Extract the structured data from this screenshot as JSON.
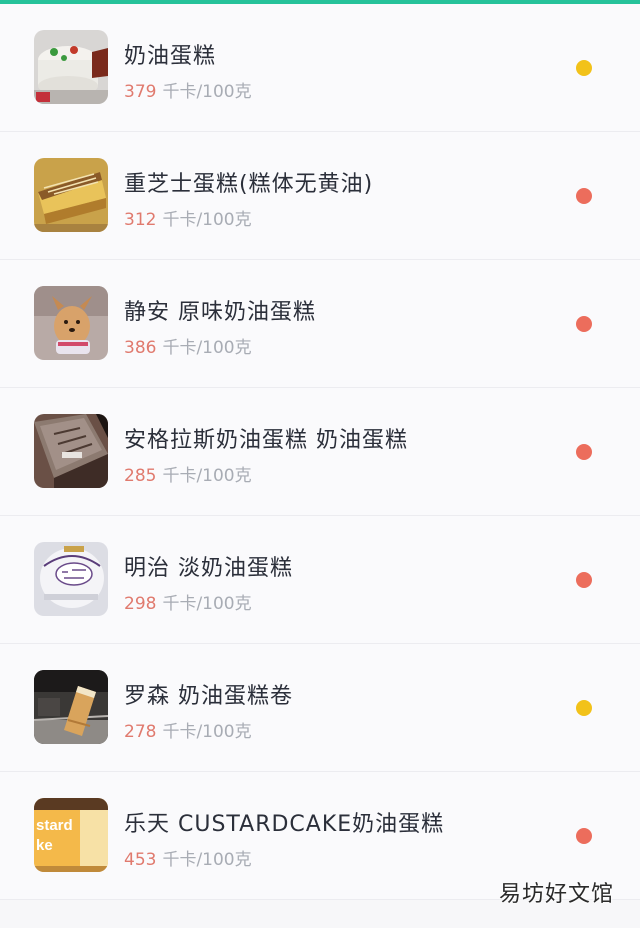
{
  "colors": {
    "accent": "#26c29a",
    "calorie_number": "#e07a6e",
    "status_yellow": "#f2c21a",
    "status_red": "#ec6d5c"
  },
  "items": [
    {
      "name": "奶油蛋糕",
      "calories": "379",
      "unit": "千卡/100克",
      "status": "yellow",
      "thumb": "cake-photo"
    },
    {
      "name": "重芝士蛋糕(糕体无黄油)",
      "calories": "312",
      "unit": "千卡/100克",
      "status": "red",
      "thumb": "cheesecake-photo"
    },
    {
      "name": "静安 原味奶油蛋糕",
      "calories": "386",
      "unit": "千卡/100克",
      "status": "red",
      "thumb": "dog-photo"
    },
    {
      "name": "安格拉斯奶油蛋糕 奶油蛋糕",
      "calories": "285",
      "unit": "千卡/100克",
      "status": "red",
      "thumb": "chocolate-cake-photo"
    },
    {
      "name": "明治 淡奶油蛋糕",
      "calories": "298",
      "unit": "千卡/100克",
      "status": "red",
      "thumb": "milk-package-photo"
    },
    {
      "name": "罗森 奶油蛋糕卷",
      "calories": "278",
      "unit": "千卡/100克",
      "status": "yellow",
      "thumb": "cake-roll-photo"
    },
    {
      "name": "乐天 CUSTARDCAKE奶油蛋糕",
      "calories": "453",
      "unit": "千卡/100克",
      "status": "red",
      "thumb": "custard-package-photo"
    }
  ],
  "watermark": "易坊好文馆"
}
